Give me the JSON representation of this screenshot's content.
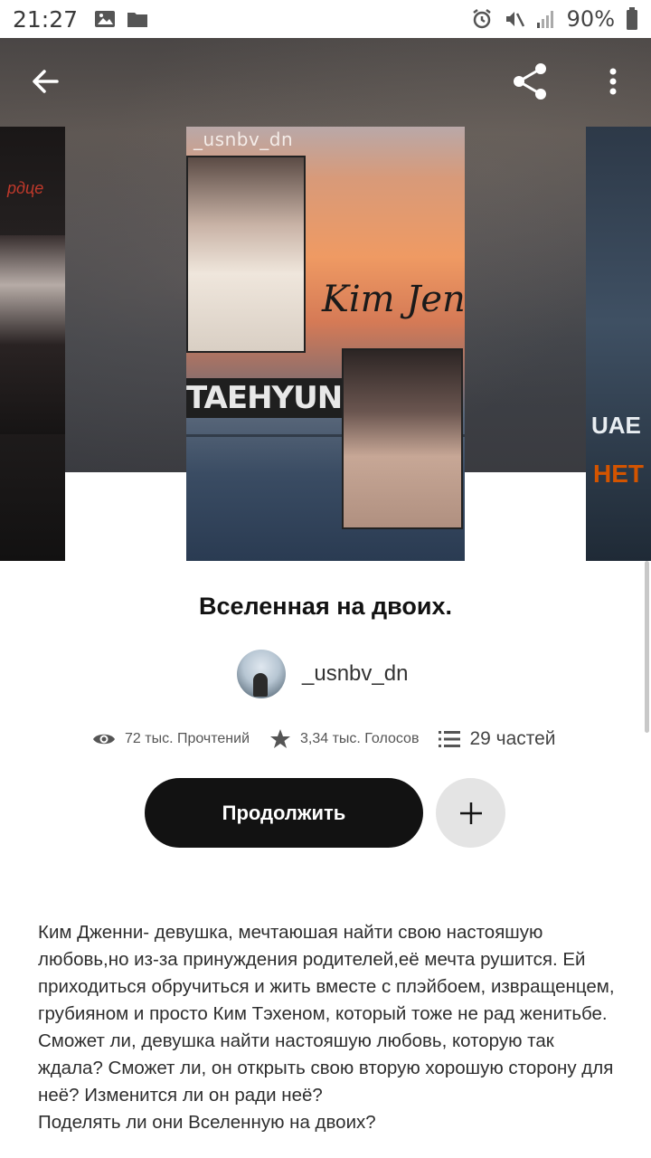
{
  "status_bar": {
    "time": "21:27",
    "battery": "90%",
    "icons": [
      "image-icon",
      "folder-icon",
      "alarm-icon",
      "mute-icon",
      "signal-icon",
      "battery-icon"
    ]
  },
  "header": {
    "back_icon": "arrow-left-icon",
    "share_icon": "share-icon",
    "more_icon": "more-vertical-icon"
  },
  "covers": {
    "main": {
      "tag": "_usnbv_dn",
      "text_1": "Kim Jen",
      "text_2": "TAEHYUNG"
    },
    "left": {
      "text": "рдце"
    },
    "right": {
      "text_1": "UAE",
      "text_2": "НЕТ"
    }
  },
  "story": {
    "title": "Вселенная на двоих.",
    "author": "_usnbv_dn",
    "reads": "72 тыс. Прочтений",
    "votes": "3,34 тыс. Голосов",
    "parts": "29 частей"
  },
  "actions": {
    "continue_label": "Продолжить",
    "add_icon": "plus-icon"
  },
  "description": "Ким Дженни- девушка, мечтаюшая найти свою настояшую любовь,но из-за принуждения родителей,её мечта рушится. Ей приходиться обручиться и жить вместе с плэйбоем, извращенцем, грубияном и просто Ким Тэхеном, который тоже не рад женитьбе.\nСможет ли, девушка найти настояшую любовь, которую так ждала? Сможет ли, он открыть свою вторую хорошую сторону для неё? Изменится ли он ради неё?\nПоделять ли они Вселенную на двоих?",
  "colors": {
    "primary_button": "#121212",
    "secondary_button": "#e4e4e4",
    "text": "#121212"
  }
}
